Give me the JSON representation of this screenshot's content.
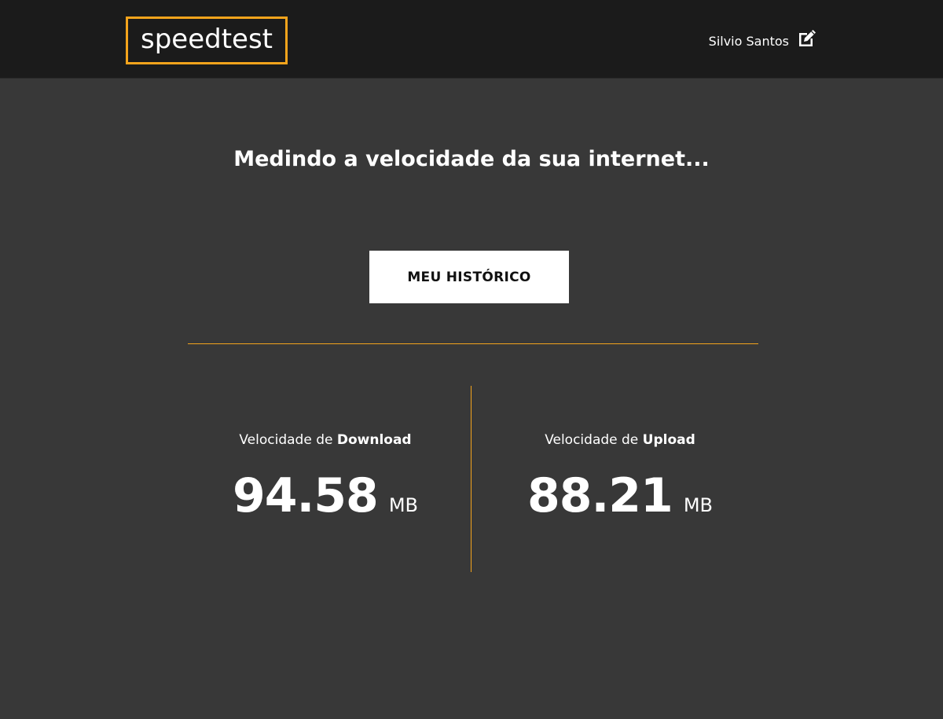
{
  "header": {
    "logo_text": "speedtest",
    "user_name": "Silvio Santos",
    "edit_icon": "edit-icon"
  },
  "main": {
    "headline": "Medindo a velocidade da sua internet...",
    "history_button_label": "MEU HISTÓRICO"
  },
  "download": {
    "label_prefix": "Velocidade de ",
    "label_strong": "Download",
    "value": "94.58",
    "unit": "MB"
  },
  "upload": {
    "label_prefix": "Velocidade de ",
    "label_strong": "Upload",
    "value": "88.21",
    "unit": "MB"
  },
  "colors": {
    "accent": "#f4a41c",
    "background": "#383838",
    "header_background": "#1b1b1b"
  }
}
